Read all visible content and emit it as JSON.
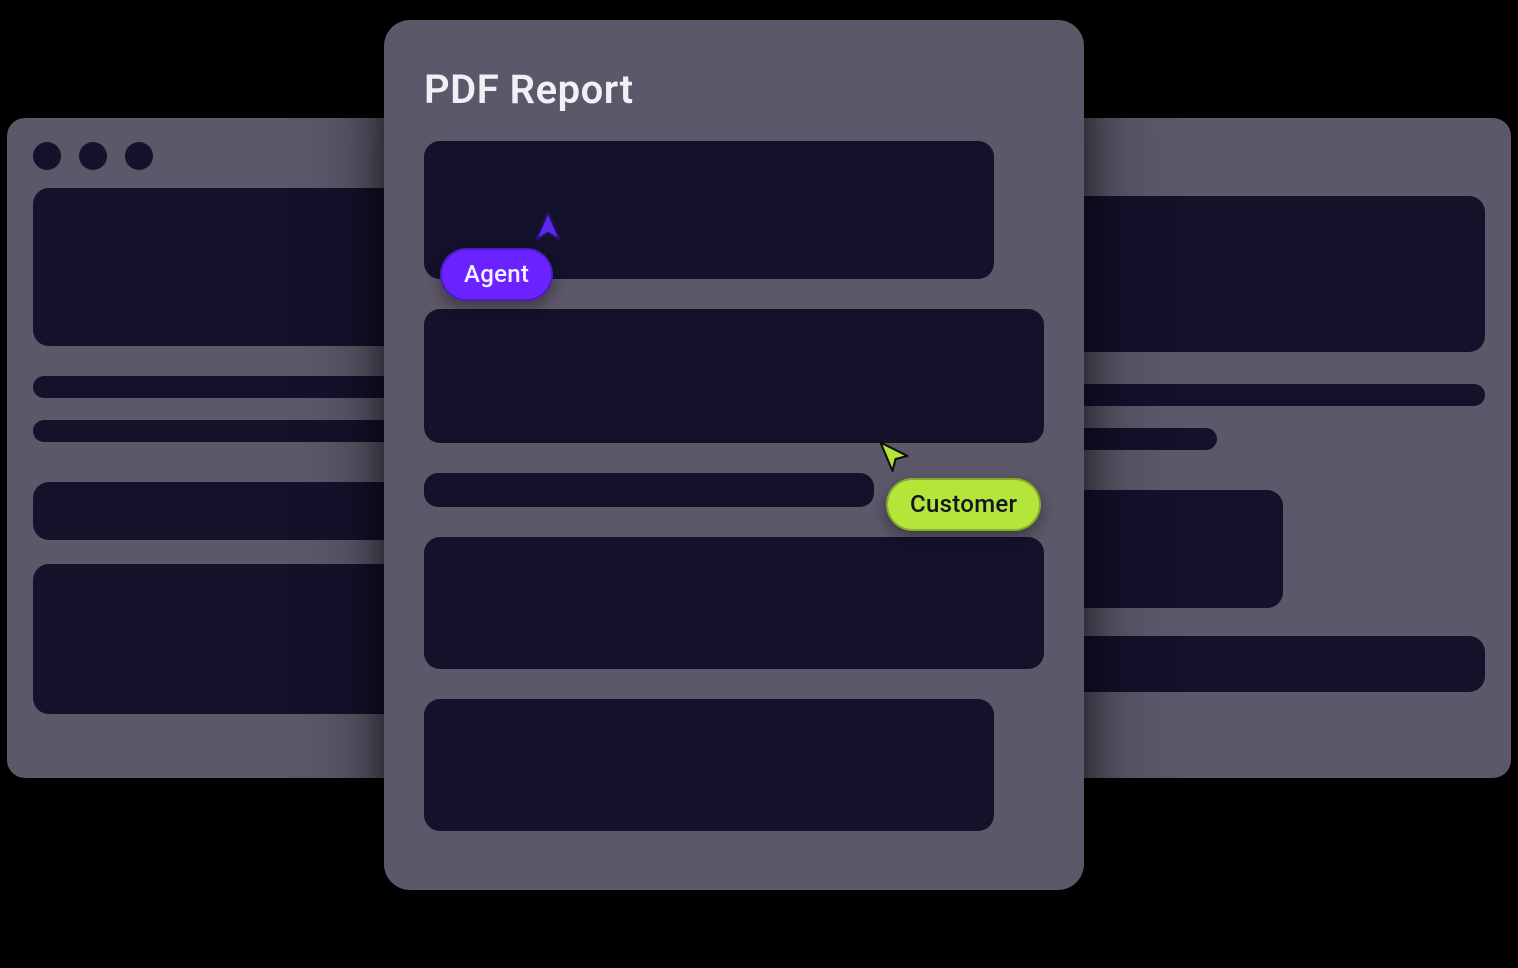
{
  "pdf": {
    "title": "PDF Report"
  },
  "cursors": {
    "agent": {
      "label": "Agent",
      "color": "#6a23ff"
    },
    "customer": {
      "label": "Customer",
      "color": "#b4e63a"
    }
  },
  "colors": {
    "panel": "#5c5769",
    "block": "#14122b",
    "text": "#f2f0f7"
  }
}
